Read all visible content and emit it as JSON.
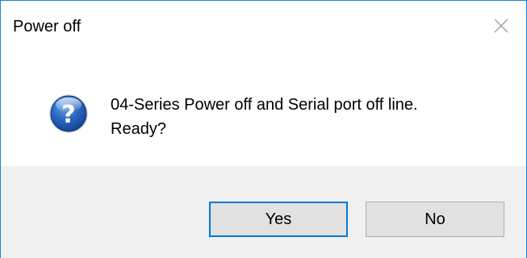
{
  "window": {
    "title": "Power off",
    "close_icon": "close-icon"
  },
  "message": {
    "icon": "question-icon",
    "text": "04-Series Power off and Serial port off line.\nReady?"
  },
  "buttons": {
    "yes_label": "Yes",
    "no_label": "No"
  },
  "colors": {
    "border": "#1883d7",
    "footer": "#f0f0f0",
    "button_face": "#e1e1e1",
    "default_button_border": "#0078d7"
  }
}
